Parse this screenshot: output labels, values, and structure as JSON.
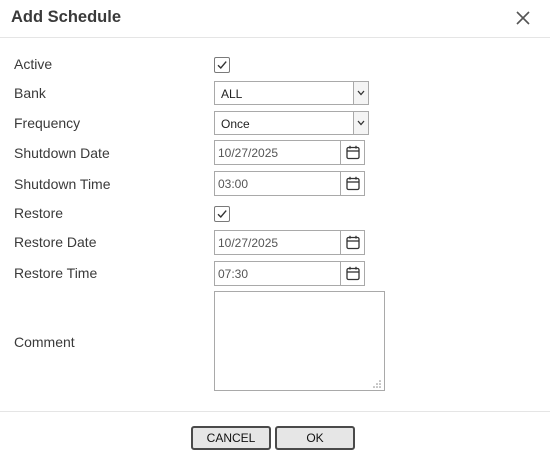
{
  "dialog": {
    "title": "Add Schedule",
    "close_icon": "close-icon"
  },
  "form": {
    "active": {
      "label": "Active",
      "checked": true
    },
    "bank": {
      "label": "Bank",
      "value": "ALL"
    },
    "frequency": {
      "label": "Frequency",
      "value": "Once"
    },
    "shutdown_date": {
      "label": "Shutdown Date",
      "value": "10/27/2025"
    },
    "shutdown_time": {
      "label": "Shutdown Time",
      "value": "03:00"
    },
    "restore": {
      "label": "Restore",
      "checked": true
    },
    "restore_date": {
      "label": "Restore Date",
      "value": "10/27/2025"
    },
    "restore_time": {
      "label": "Restore Time",
      "value": "07:30"
    },
    "comment": {
      "label": "Comment",
      "value": ""
    }
  },
  "buttons": {
    "cancel": "CANCEL",
    "ok": "OK"
  },
  "icons": {
    "checkbox": "checkmark-icon",
    "dropdown": "chevron-down-icon",
    "calendar": "calendar-icon",
    "resize": "resize-grip-icon"
  }
}
